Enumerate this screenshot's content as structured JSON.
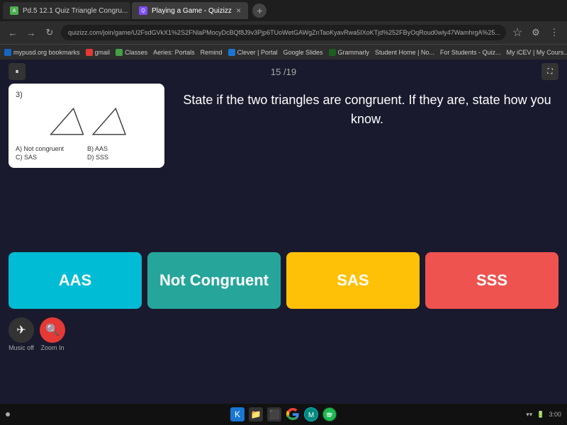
{
  "browser": {
    "tabs": [
      {
        "id": "tab1",
        "label": "Pd.5 12.1 Quiz Triangle Congru...",
        "favicon_color": "#4CAF50",
        "active": false,
        "favicon_letter": "A"
      },
      {
        "id": "tab2",
        "label": "Playing a Game - Quizizz",
        "favicon_color": "#7c4dff",
        "active": true,
        "favicon_letter": "Q"
      }
    ],
    "address": "quizizz.com/join/game/U2FsdGVkX1%2S2FNlaPMocyDcBQf8J9v3Pjp6TUoWetGAWgZnTaoKyavRwa5IXoKTjd%252FByOqRoud0wly47WamhrgA%25...",
    "bookmarks": [
      "mypusd.org bookmarks",
      "gmail",
      "Classes",
      "Aeries: Portals",
      "Remind",
      "Clever | Portal",
      "Google Slides",
      "Grammarly",
      "Student Home | No...",
      "For Students - Quiz...",
      "My iCEV | My Cours..."
    ]
  },
  "game": {
    "pause_label": "⏸",
    "question_counter": "15 /19",
    "fullscreen_label": "⛶",
    "question_number": "3)",
    "question_text": "State if the two triangles are congruent. If they are, state how you know.",
    "choices_label_a": "A) Not congruent",
    "choices_label_b": "B) AAS",
    "choices_label_c": "C) SAS",
    "choices_label_d": "D) SSS",
    "answers": [
      {
        "id": "aas",
        "label": "AAS",
        "color": "#00bcd4",
        "class": "answer-aas"
      },
      {
        "id": "not-congruent",
        "label": "Not Congruent",
        "color": "#26a69a",
        "class": "answer-not-congruent"
      },
      {
        "id": "sas",
        "label": "SAS",
        "color": "#ffc107",
        "class": "answer-sas"
      },
      {
        "id": "sss",
        "label": "SSS",
        "color": "#ef5350",
        "class": "answer-sss"
      }
    ],
    "bottom_buttons": [
      {
        "id": "music-off",
        "label": "Music off",
        "icon": "✈",
        "color": "#333"
      },
      {
        "id": "zoom-in",
        "label": "Zoom In",
        "icon": "🔍",
        "color": "#e53935"
      }
    ]
  },
  "taskbar": {
    "time": "3:00",
    "wifi_icon": "wifi",
    "battery_icon": "battery"
  }
}
